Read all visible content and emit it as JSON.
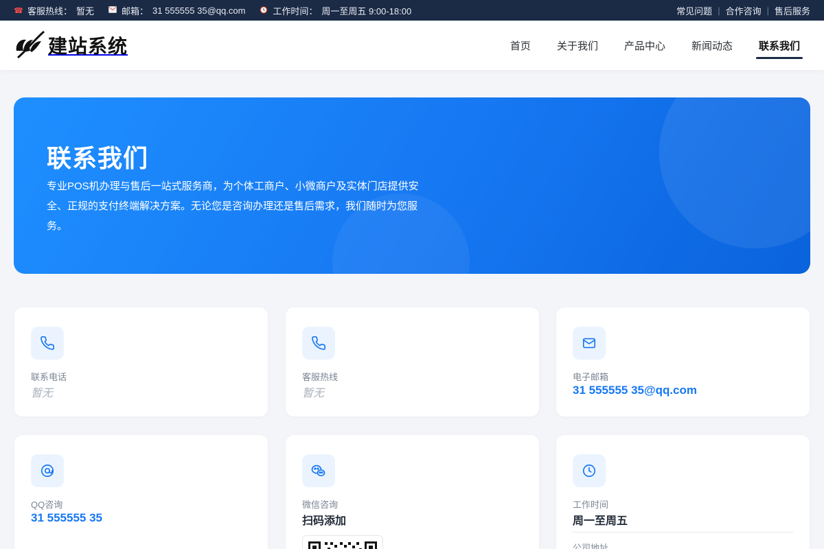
{
  "topbar": {
    "hotline_label": "客服热线：",
    "hotline_value": "暂无",
    "email_label": "邮箱：",
    "email_value": "31 555555 35@qq.com",
    "hours_label": "工作时间：",
    "hours_value": "周一至周五 9:00-18:00",
    "links": [
      "常见问题",
      "合作咨询",
      "售后服务"
    ]
  },
  "header": {
    "logo_text": "建站系统",
    "nav": [
      "首页",
      "关于我们",
      "产品中心",
      "新闻动态",
      "联系我们"
    ],
    "active_nav": "联系我们"
  },
  "hero": {
    "title": "联系我们",
    "description": "专业POS机办理与售后一站式服务商，为个体工商户、小微商户及实体门店提供安全、正规的支付终端解决方案。无论您是咨询办理还是售后需求，我们随时为您服务。"
  },
  "cards": [
    {
      "icon": "phone-icon",
      "label": "联系电话",
      "value": "暂无"
    },
    {
      "icon": "phone-icon",
      "label": "客服热线",
      "value": "暂无"
    },
    {
      "icon": "mail-icon",
      "label": "电子邮箱",
      "value": "31 555555 35@qq.com"
    },
    {
      "icon": "qq-icon",
      "label": "QQ咨询",
      "value": "31 555555 35"
    },
    {
      "icon": "wechat-icon",
      "label": "微信咨询",
      "value": "扫码添加"
    },
    {
      "icon": "clock-icon",
      "label": "工作时间",
      "value": "周一至周五",
      "label2": "公司地址"
    }
  ],
  "colors": {
    "accent": "#1677f2",
    "topbar_bg": "#1b2a45",
    "icon_bg": "#ebf4fe"
  }
}
